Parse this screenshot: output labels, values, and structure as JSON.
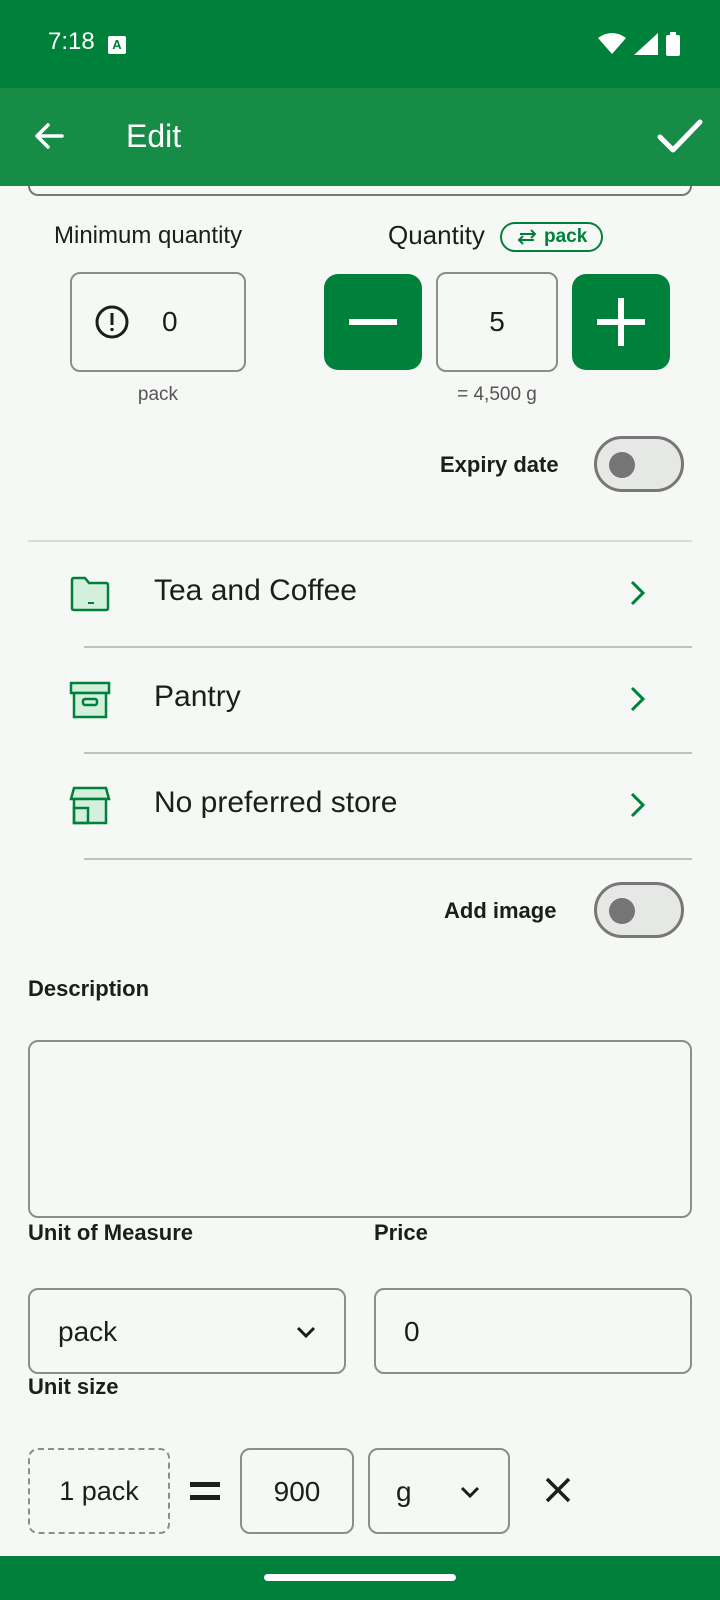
{
  "status_bar": {
    "time": "7:18",
    "notification_badge": "A"
  },
  "app_bar": {
    "title": "Edit"
  },
  "min_quantity": {
    "label": "Minimum quantity",
    "value": "0",
    "unit": "pack"
  },
  "quantity": {
    "label": "Quantity",
    "unit_chip": "pack",
    "value": "5",
    "equivalent": "= 4,500 g"
  },
  "expiry_date": {
    "label": "Expiry date",
    "enabled": false
  },
  "list_rows": [
    {
      "label": "Tea and Coffee",
      "icon": "folder-icon"
    },
    {
      "label": "Pantry",
      "icon": "archive-box-icon"
    },
    {
      "label": "No preferred store",
      "icon": "store-icon"
    }
  ],
  "add_image": {
    "label": "Add image",
    "enabled": false
  },
  "description": {
    "label": "Description",
    "value": ""
  },
  "unit_of_measure": {
    "label": "Unit of Measure",
    "value": "pack"
  },
  "price": {
    "label": "Price",
    "value": "0"
  },
  "unit_size": {
    "label": "Unit size",
    "from": "1 pack",
    "amount": "900",
    "unit": "g"
  },
  "colors": {
    "primary": "#00813b",
    "app_bar": "#168c47",
    "background": "#f6f8f5"
  }
}
